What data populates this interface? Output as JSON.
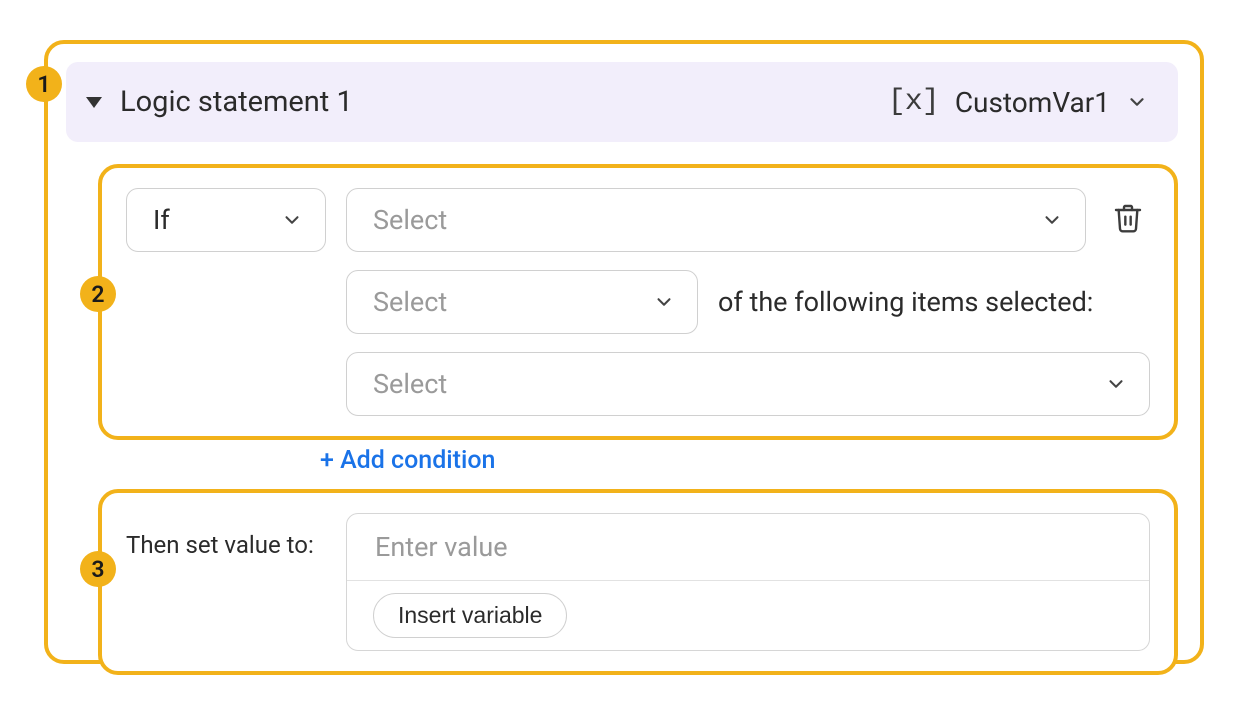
{
  "badges": {
    "one": "1",
    "two": "2",
    "three": "3"
  },
  "header": {
    "title": "Logic statement 1",
    "variable_name": "CustomVar1"
  },
  "condition": {
    "op_label": "If",
    "select1_placeholder": "Select",
    "select2_placeholder": "Select",
    "middle_text": "of the following items selected:",
    "select3_placeholder": "Select"
  },
  "add_condition_label": "+ Add condition",
  "then": {
    "label": "Then set value to:",
    "input_placeholder": "Enter value",
    "insert_variable_label": "Insert variable"
  }
}
